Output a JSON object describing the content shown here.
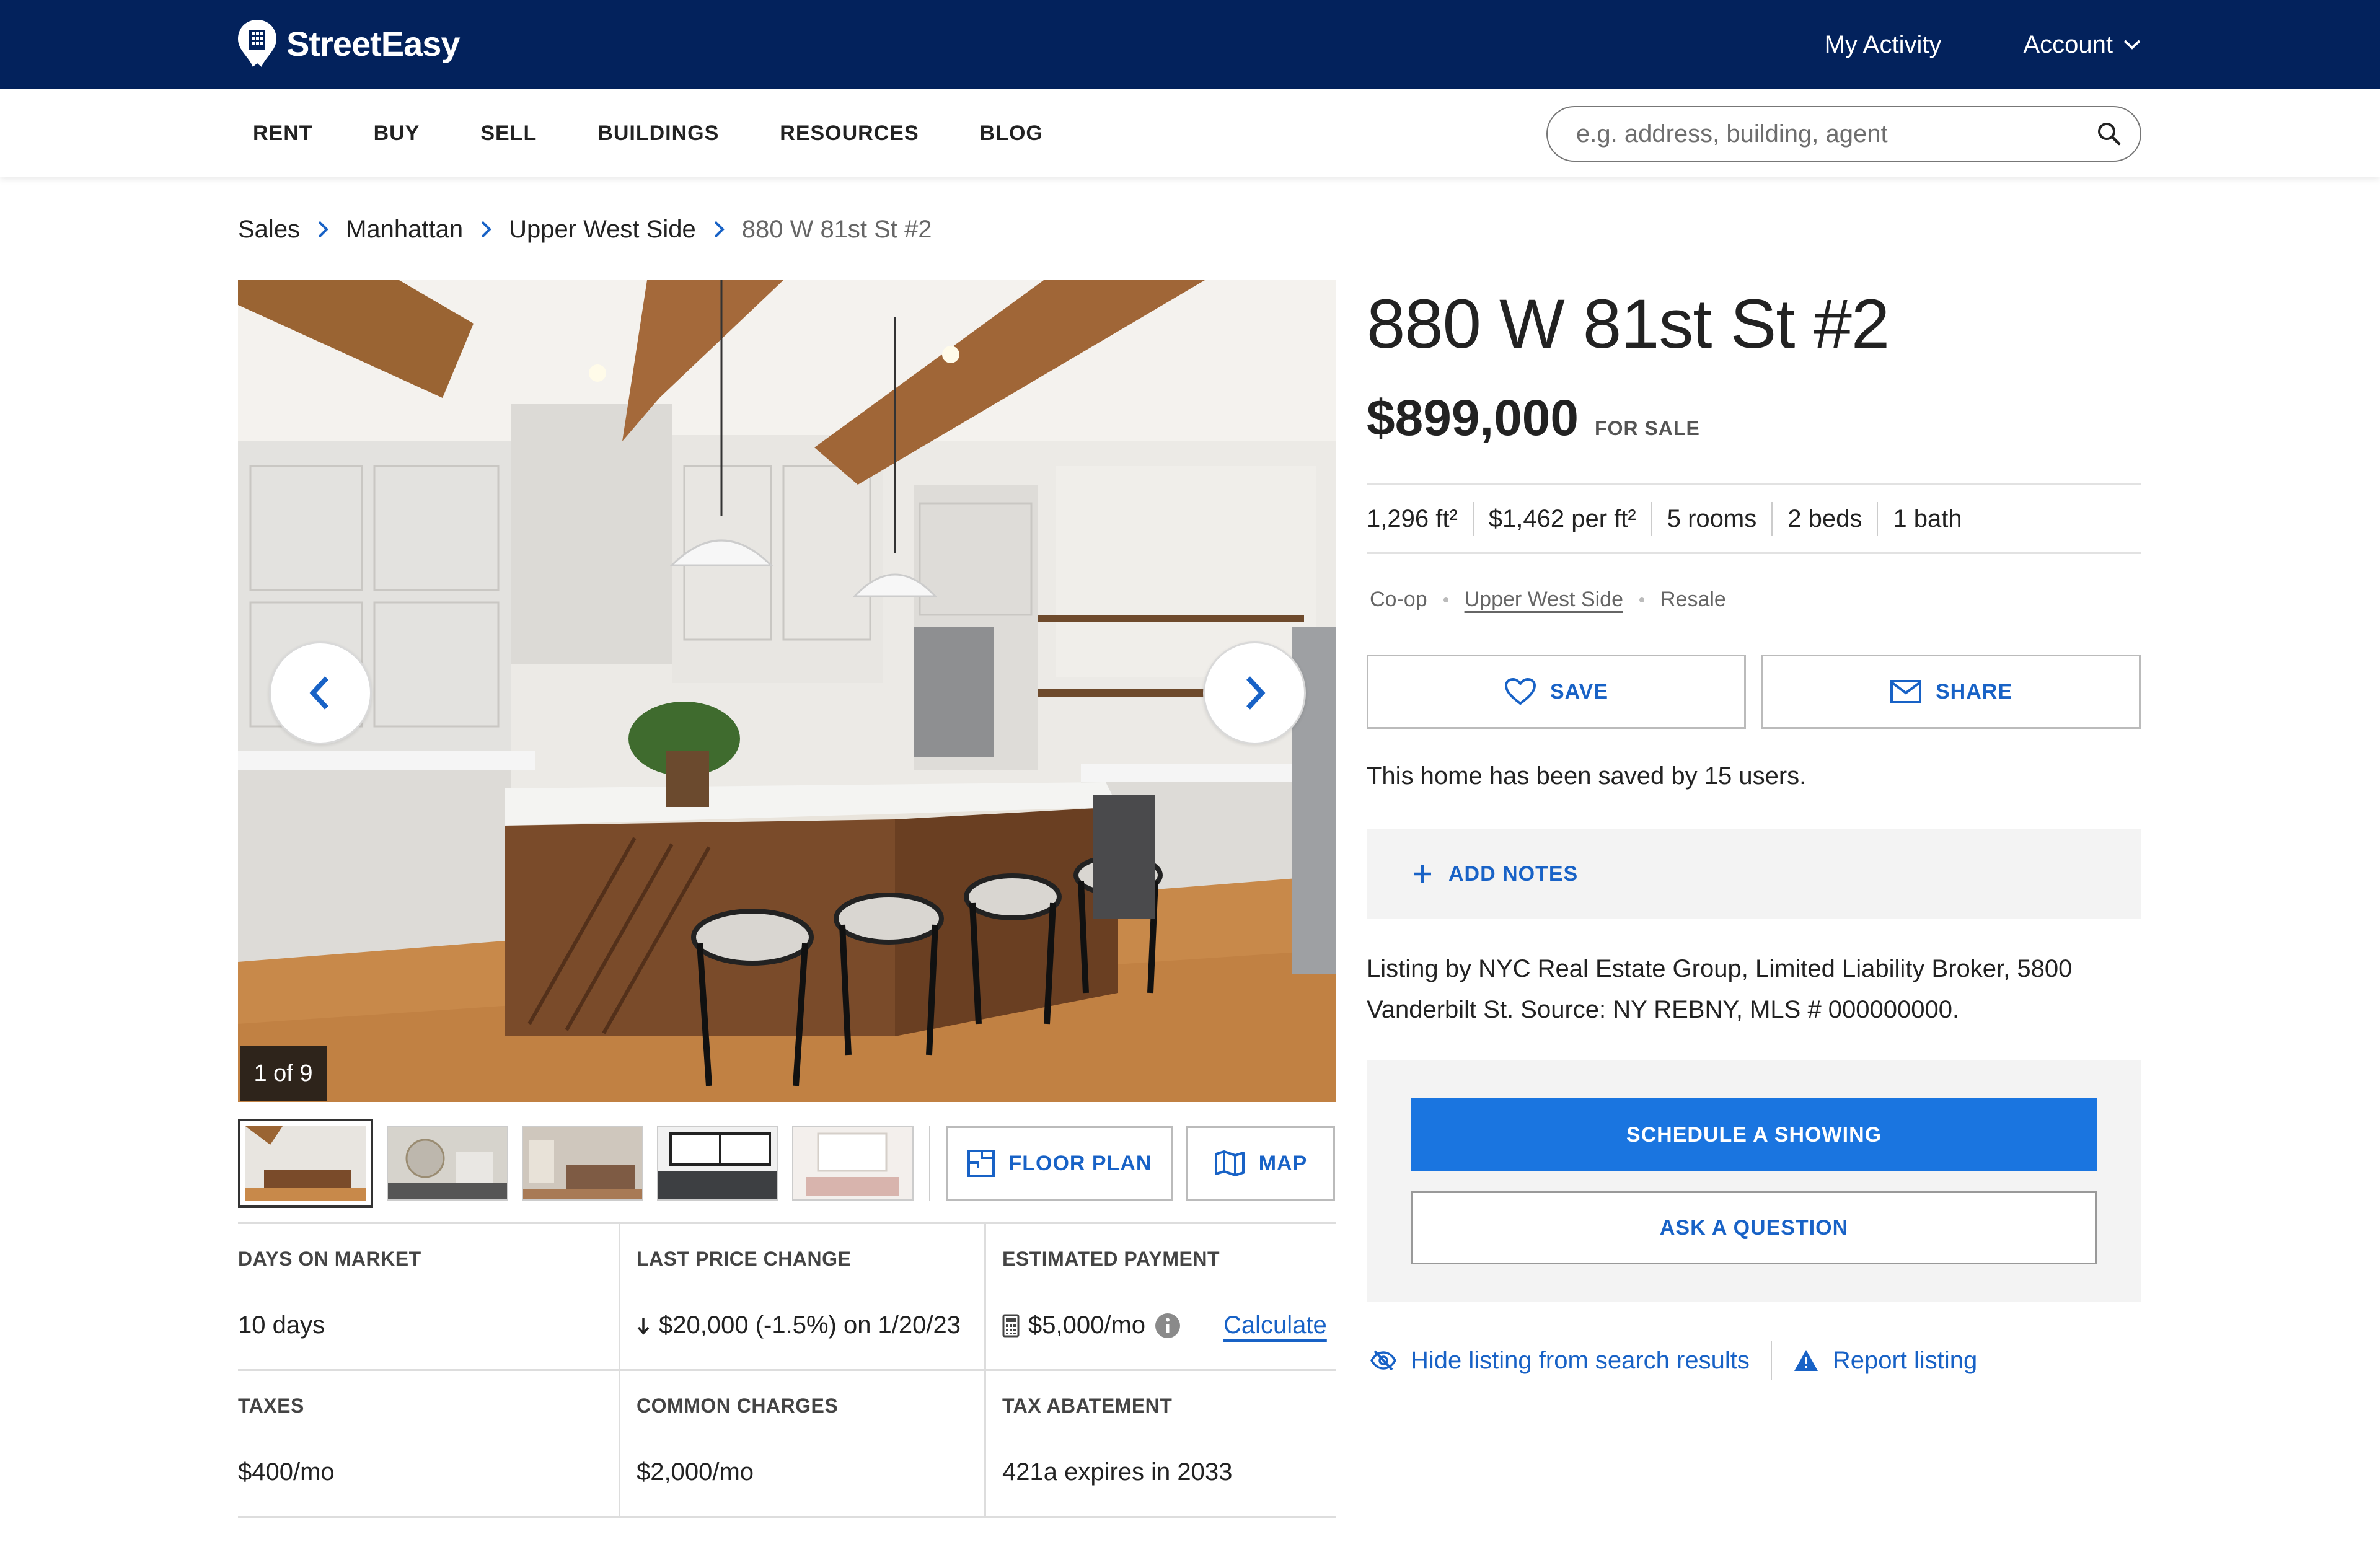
{
  "brand": {
    "name": "StreetEasy"
  },
  "top_nav": {
    "my_activity": "My Activity",
    "account": "Account"
  },
  "main_nav": {
    "items": [
      "RENT",
      "BUY",
      "SELL",
      "BUILDINGS",
      "RESOURCES",
      "BLOG"
    ]
  },
  "search": {
    "placeholder": "e.g. address, building, agent"
  },
  "breadcrumb": {
    "items": [
      "Sales",
      "Manhattan",
      "Upper West Side",
      "880 W 81st St #2"
    ]
  },
  "gallery": {
    "counter": "1 of 9",
    "floor_plan": "FLOOR PLAN",
    "map": "MAP"
  },
  "listing": {
    "title": "880 W 81st St #2",
    "price": "$899,000",
    "status": "FOR SALE",
    "area_unit": "ft²",
    "facts": [
      "1,296",
      "$1,462 per",
      "5 rooms",
      "2 beds",
      "1 bath"
    ],
    "tags": [
      "Co-op",
      "Upper West Side",
      "Resale"
    ],
    "save": "SAVE",
    "share": "SHARE",
    "saved_text": "This home has been saved by 15 users.",
    "add_notes": "ADD NOTES",
    "listing_by": "Listing by NYC Real Estate Group, Limited Liability Broker, 5800 Vanderbilt St. Source: NY REBNY, MLS # 000000000.",
    "schedule": "SCHEDULE A SHOWING",
    "ask": "ASK A QUESTION",
    "hide": "Hide listing from search results",
    "report": "Report listing"
  },
  "stats": {
    "days_label": "DAYS ON MARKET",
    "days_value": "10 days",
    "price_change_label": "LAST PRICE CHANGE",
    "price_change_value": "$20,000 (-1.5%) on 1/20/23",
    "payment_label": "ESTIMATED PAYMENT",
    "payment_value": "$5,000/mo",
    "calculate": "Calculate",
    "taxes_label": "TAXES",
    "taxes_value": "$400/mo",
    "common_label": "COMMON CHARGES",
    "common_value": "$2,000/mo",
    "abatement_label": "TAX ABATEMENT",
    "abatement_value": "421a expires in 2033"
  },
  "colors": {
    "header": "#03225c",
    "accent": "#1862c6",
    "primary": "#1a75e0"
  }
}
